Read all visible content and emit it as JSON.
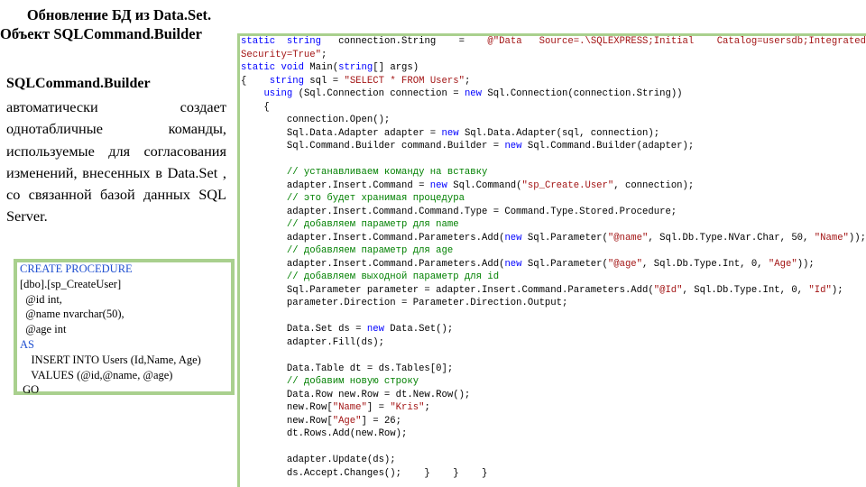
{
  "slide": {
    "title_line1": "Обновление БД из Data.Set.",
    "title_line2": "Объект SQLCommand.Builder",
    "subheading": "SQLCommand.Builder",
    "description": "автоматически создает однотабличные команды, используемые для согласования изменений, внесенных в Data.Set , со связанной базой данных SQL Server."
  },
  "sql_procedure": {
    "lines": [
      {
        "text": "CREATE PROCEDURE",
        "kw": true
      },
      {
        "text": "[dbo].[sp_CreateUser]",
        "kw": false
      },
      {
        "text": "  @id int,",
        "kw": false
      },
      {
        "text": "  @name nvarchar(50),",
        "kw": false
      },
      {
        "text": "  @age int",
        "kw": false
      },
      {
        "text": "AS",
        "kw": true
      },
      {
        "text": "    INSERT INTO Users (Id,Name, Age)",
        "kw": false
      },
      {
        "text": "    VALUES (@id,@name, @age)",
        "kw": false
      },
      {
        "text": " GO",
        "kw": false
      }
    ]
  },
  "csharp_code": {
    "lines": [
      [
        {
          "t": "static",
          "c": "kw"
        },
        {
          "t": "  "
        },
        {
          "t": "string",
          "c": "kw"
        },
        {
          "t": "   connection.String    =    "
        },
        {
          "t": "@\"Data   Source=.\\SQLEXPRESS;Initial    Catalog=usersdb;Integrated",
          "c": "st"
        }
      ],
      [
        {
          "t": "Security=True\"",
          "c": "st"
        },
        {
          "t": ";"
        }
      ],
      [
        {
          "t": "static",
          "c": "kw"
        },
        {
          "t": " "
        },
        {
          "t": "void",
          "c": "kw"
        },
        {
          "t": " Main("
        },
        {
          "t": "string",
          "c": "kw"
        },
        {
          "t": "[] args)"
        }
      ],
      [
        {
          "t": "{    "
        },
        {
          "t": "string",
          "c": "kw"
        },
        {
          "t": " sql = "
        },
        {
          "t": "\"SELECT * FROM Users\"",
          "c": "st"
        },
        {
          "t": ";"
        }
      ],
      [
        {
          "t": "    "
        },
        {
          "t": "using",
          "c": "kw"
        },
        {
          "t": " (Sql.Connection connection = "
        },
        {
          "t": "new",
          "c": "kw"
        },
        {
          "t": " Sql.Connection(connection.String))"
        }
      ],
      [
        {
          "t": "    {"
        }
      ],
      [
        {
          "t": "        connection.Open();"
        }
      ],
      [
        {
          "t": "        Sql.Data.Adapter adapter = "
        },
        {
          "t": "new",
          "c": "kw"
        },
        {
          "t": " Sql.Data.Adapter(sql, connection);"
        }
      ],
      [
        {
          "t": "        Sql.Command.Builder command.Builder = "
        },
        {
          "t": "new",
          "c": "kw"
        },
        {
          "t": " Sql.Command.Builder(adapter);"
        }
      ],
      [
        {
          "t": ""
        }
      ],
      [
        {
          "t": "        "
        },
        {
          "t": "// устанавливаем команду на вставку",
          "c": "cm"
        }
      ],
      [
        {
          "t": "        adapter.Insert.Command = "
        },
        {
          "t": "new",
          "c": "kw"
        },
        {
          "t": " Sql.Command("
        },
        {
          "t": "\"sp_Create.User\"",
          "c": "st"
        },
        {
          "t": ", connection);"
        }
      ],
      [
        {
          "t": "        "
        },
        {
          "t": "// это будет хранимая процедура",
          "c": "cm"
        }
      ],
      [
        {
          "t": "        adapter.Insert.Command.Command.Type = Command.Type.Stored.Procedure;"
        }
      ],
      [
        {
          "t": "        "
        },
        {
          "t": "// добавляем параметр для name",
          "c": "cm"
        }
      ],
      [
        {
          "t": "        adapter.Insert.Command.Parameters.Add("
        },
        {
          "t": "new",
          "c": "kw"
        },
        {
          "t": " Sql.Parameter("
        },
        {
          "t": "\"@name\"",
          "c": "st"
        },
        {
          "t": ", Sql.Db.Type.NVar.Char, 50, "
        },
        {
          "t": "\"Name\"",
          "c": "st"
        },
        {
          "t": "));"
        }
      ],
      [
        {
          "t": "        "
        },
        {
          "t": "// добавляем параметр для age",
          "c": "cm"
        }
      ],
      [
        {
          "t": "        adapter.Insert.Command.Parameters.Add("
        },
        {
          "t": "new",
          "c": "kw"
        },
        {
          "t": " Sql.Parameter("
        },
        {
          "t": "\"@age\"",
          "c": "st"
        },
        {
          "t": ", Sql.Db.Type.Int, 0, "
        },
        {
          "t": "\"Age\"",
          "c": "st"
        },
        {
          "t": "));"
        }
      ],
      [
        {
          "t": "        "
        },
        {
          "t": "// добавляем выходной параметр для id",
          "c": "cm"
        }
      ],
      [
        {
          "t": "        Sql.Parameter parameter = adapter.Insert.Command.Parameters.Add("
        },
        {
          "t": "\"@Id\"",
          "c": "st"
        },
        {
          "t": ", Sql.Db.Type.Int, 0, "
        },
        {
          "t": "\"Id\"",
          "c": "st"
        },
        {
          "t": ");"
        }
      ],
      [
        {
          "t": "        parameter.Direction = Parameter.Direction.Output;"
        }
      ],
      [
        {
          "t": ""
        }
      ],
      [
        {
          "t": "        Data.Set ds = "
        },
        {
          "t": "new",
          "c": "kw"
        },
        {
          "t": " Data.Set();"
        }
      ],
      [
        {
          "t": "        adapter.Fill(ds);"
        }
      ],
      [
        {
          "t": ""
        }
      ],
      [
        {
          "t": "        Data.Table dt = ds.Tables[0];"
        }
      ],
      [
        {
          "t": "        "
        },
        {
          "t": "// добавим новую строку",
          "c": "cm"
        }
      ],
      [
        {
          "t": "        Data.Row new.Row = dt.New.Row();"
        }
      ],
      [
        {
          "t": "        new.Row["
        },
        {
          "t": "\"Name\"",
          "c": "st"
        },
        {
          "t": "] = "
        },
        {
          "t": "\"Kris\"",
          "c": "st"
        },
        {
          "t": ";"
        }
      ],
      [
        {
          "t": "        new.Row["
        },
        {
          "t": "\"Age\"",
          "c": "st"
        },
        {
          "t": "] = 26;"
        }
      ],
      [
        {
          "t": "        dt.Rows.Add(new.Row);"
        }
      ],
      [
        {
          "t": ""
        }
      ],
      [
        {
          "t": "        adapter.Update(ds);"
        }
      ],
      [
        {
          "t": "        ds.Accept.Changes();    }    }    }"
        }
      ]
    ]
  }
}
